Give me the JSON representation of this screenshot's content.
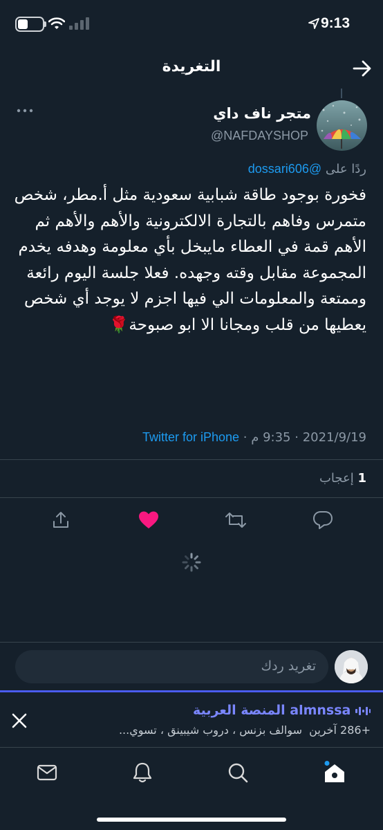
{
  "status_bar": {
    "time": "9:13"
  },
  "header": {
    "title": "التغريدة"
  },
  "tweet": {
    "display_name": "متجر ناف داي",
    "handle": "@NAFDAYSHOP",
    "reply_prefix": "ردًا على",
    "reply_to": "@dossari606",
    "text": "فخورة بوجود طاقة شبابية سعودية مثل أ.مطر، شخص متمرس وفاهم بالتجارة الالكترونية والأهم والأهم ثم الأهم قمة في العطاء مايبخل بأي معلومة وهدفه يخدم المجموعة مقابل وقته وجهده. فعلا جلسة اليوم رائعة وممتعة والمعلومات الي فيها اجزم لا يوجد أي شخص يعطيها من قلب ومجانا الا ابو صبوحة🌹",
    "date": "2021/9/19",
    "time": "9:35 م",
    "separator": "·",
    "source": "Twitter for iPhone",
    "likes_count": "1",
    "likes_label": "إعجاب"
  },
  "composer": {
    "placeholder": "تغريد ردك"
  },
  "spaces": {
    "title": "almnssa المنصة العربية",
    "subtitle_others": "+286 آخرين",
    "subtitle_topics": "سوالف بزنس ، دروب شيبينق ، تسوي..."
  },
  "colors": {
    "background": "#15202b",
    "accent": "#1d9bf0",
    "like": "#f91880",
    "spaces_accent": "#7a86ff",
    "muted": "#8b98a5"
  },
  "icons": {
    "back": "arrow-right-icon",
    "more": "more-dots-icon",
    "share": "share-icon",
    "like": "heart-filled-icon",
    "retweet": "retweet-icon",
    "reply": "reply-icon",
    "close": "close-icon",
    "nav": [
      "mail-icon",
      "bell-icon",
      "search-icon",
      "home-icon"
    ]
  }
}
